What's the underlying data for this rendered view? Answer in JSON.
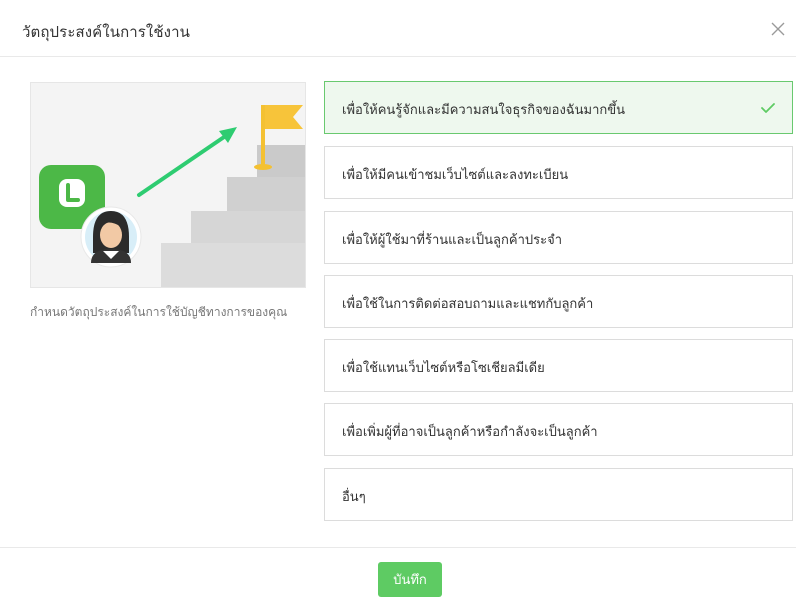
{
  "dialog": {
    "title": "วัตถุประสงค์ในการใช้งาน"
  },
  "sidebar": {
    "description": "กำหนดวัตถุประสงค์ในการใช้บัญชีทางการของคุณ"
  },
  "options": [
    {
      "label": "เพื่อให้คนรู้จักและมีความสนใจธุรกิจของฉันมากขึ้น",
      "selected": true
    },
    {
      "label": "เพื่อให้มีคนเข้าชมเว็บไซต์และลงทะเบียน",
      "selected": false
    },
    {
      "label": "เพื่อให้ผู้ใช้มาที่ร้านและเป็นลูกค้าประจำ",
      "selected": false
    },
    {
      "label": "เพื่อใช้ในการติดต่อสอบถามและแชทกับลูกค้า",
      "selected": false
    },
    {
      "label": "เพื่อใช้แทนเว็บไซต์หรือโซเชียลมีเดีย",
      "selected": false
    },
    {
      "label": "เพื่อเพิ่มผู้ที่อาจเป็นลูกค้าหรือกำลังจะเป็นลูกค้า",
      "selected": false
    },
    {
      "label": "อื่นๆ",
      "selected": false
    }
  ],
  "footer": {
    "save_label": "บันทึก"
  },
  "icons": {
    "close": "close-icon",
    "check": "check-icon",
    "app_logo": "line-logo-icon",
    "flag": "flag-icon"
  },
  "colors": {
    "accent": "#5ecb63",
    "selected_bg": "#eef8ee",
    "selected_border": "#69c96f",
    "arrow": "#2ecc71",
    "flag": "#f7c43a",
    "logo": "#4cb847"
  }
}
